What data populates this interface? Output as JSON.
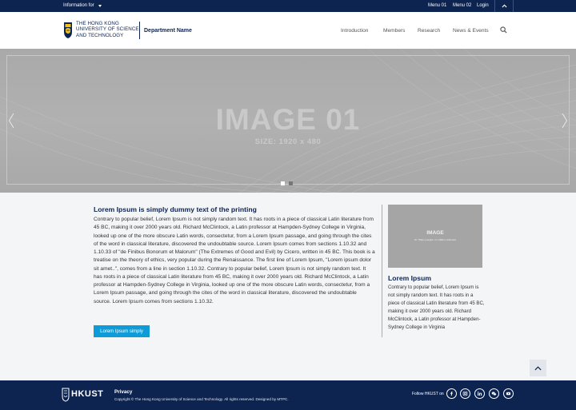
{
  "topbar": {
    "info_label": "Information for",
    "menu1": "Menu 01",
    "menu2": "Menu 02",
    "login": "Login"
  },
  "header": {
    "logo_lines": [
      "THE HONG KONG",
      "UNIVERSITY OF SCIENCE",
      "AND TECHNOLOGY"
    ],
    "department": "Department Name",
    "nav": [
      "Introduction",
      "Members",
      "Research",
      "News & Events"
    ]
  },
  "hero": {
    "title": "IMAGE 01",
    "subtitle": "SIZE: 1920 x 480",
    "slides": 2,
    "active_slide": 1
  },
  "main": {
    "heading": "Lorem Ipsum is simply dummy text of the printing",
    "body": "Contrary to popular belief, Lorem Ipsum is not simply random text. It has roots in a piece of classical Latin literature from 45 BC, making it over 2000 years old. Richard McClintock, a Latin professor at Hampden-Sydney College in Virginia, looked up one of the more obscure Latin words, consectetur, from a Lorem Ipsum passage, and going through the cites of the word in classical literature, discovered the undoubtable source. Lorem Ipsum comes from sections 1.10.32 and 1.10.33 of \"de Finibus Bonorum et Malorum\" (The Extremes of Good and Evil) by Cicero, written in 45 BC. This book is a treatise on the theory of ethics, very popular during the Renaissance. The first line of Lorem Ipsum, \"Lorem ipsum dolor sit amet..\", comes from a line in section 1.10.32. Contrary to popular belief, Lorem Ipsum is not simply random text. It has roots in a piece of classical Latin literature from 45 BC, making it over 2000 years old. Richard McClintock, a Latin professor at Hampden-Sydney College in Virginia, looked up one of the more obscure Latin words, consectetur, from a Lorem Ipsum passage, and going through the cites of the word in classical literature, discovered the undoubtable source. Lorem Ipsum comes from sections 1.10.32.",
    "button": "Lorem Ipsum simply"
  },
  "side": {
    "image_title": "IMAGE",
    "image_caption": "W: 750px (Height x H: Million Unlimited",
    "heading": "Lorem Ipsum",
    "body": "Contrary to popular belief, Lorem Ipsum is not simply random text. It has roots in a piece of classical Latin literature from 45 BC, making it over 2000 years old. Richard McClintock, a Latin professor at Hampden-Sydney College in Virginia"
  },
  "footer": {
    "brand": "HKUST",
    "privacy": "Privacy",
    "copyright": "Copyright © The Hong Kong University of Science and Technology. All rights reserved. Designed by MTPC.",
    "follow": "Follow HKUST on",
    "social": [
      "facebook-icon",
      "instagram-icon",
      "linkedin-icon",
      "wechat-icon",
      "youtube-icon"
    ]
  },
  "colors": {
    "navy": "#0d2451",
    "accent": "#0e9bd8",
    "background": "#f4f5f7"
  }
}
